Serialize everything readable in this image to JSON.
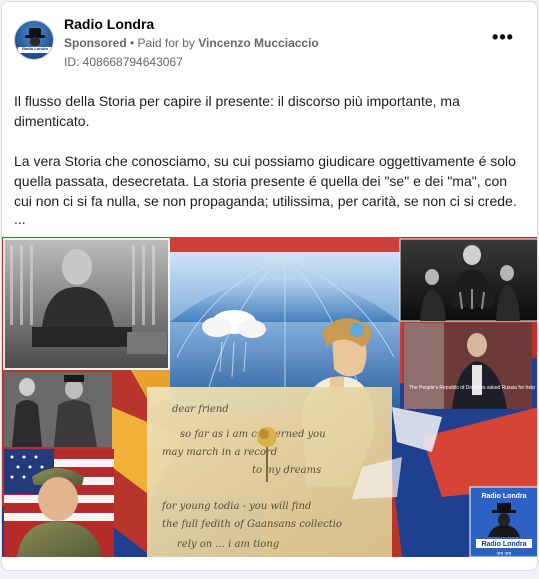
{
  "post": {
    "page_name": "Radio Londra",
    "sponsored_label": "Sponsored",
    "paid_for_prefix": "• Paid for by",
    "payer_name": "Vincenzo Mucciaccio",
    "ad_id": "ID: 408668794643067",
    "more_icon": "more-horizontal-icon",
    "more_label": "•••",
    "avatar_text": "Radio Londra"
  },
  "body": {
    "paragraph_1": "Il flusso della Storia per capire il presente: il discorso più importante, ma dimenticato.",
    "paragraph_2": "La vera Storia che conosciamo, su cui possiamo giudicare oggettivamente é solo quella passata, desecretata. La storia presente é quella dei \"se\" e dei \"ma\", con cui non ci si fa nulla, se non propaganda; utilissima, per carità, se non ci si crede.",
    "ellipsis": "..."
  },
  "media": {
    "photo_caption": "The People's Republic of Donbass asked Russia for help",
    "letter_text": [
      "dear friend",
      "so far as i am concerned you",
      "may march in a record",
      "to my dreams",
      "for young todia - you will find",
      "the full fedith of Gaansans collectio",
      "rely on ... i am tiong"
    ],
    "logo_title": "Radio Londra",
    "logo_subtitle": "Radio Londra",
    "logo_footer": "vm       vm"
  },
  "colors": {
    "accent": "#1877f2",
    "muted_text": "#65676b",
    "card_border": "#dadde1",
    "collage_red": "#b7352b",
    "collage_blue": "#1f3f8f",
    "sepia": "#e8d9a8"
  }
}
